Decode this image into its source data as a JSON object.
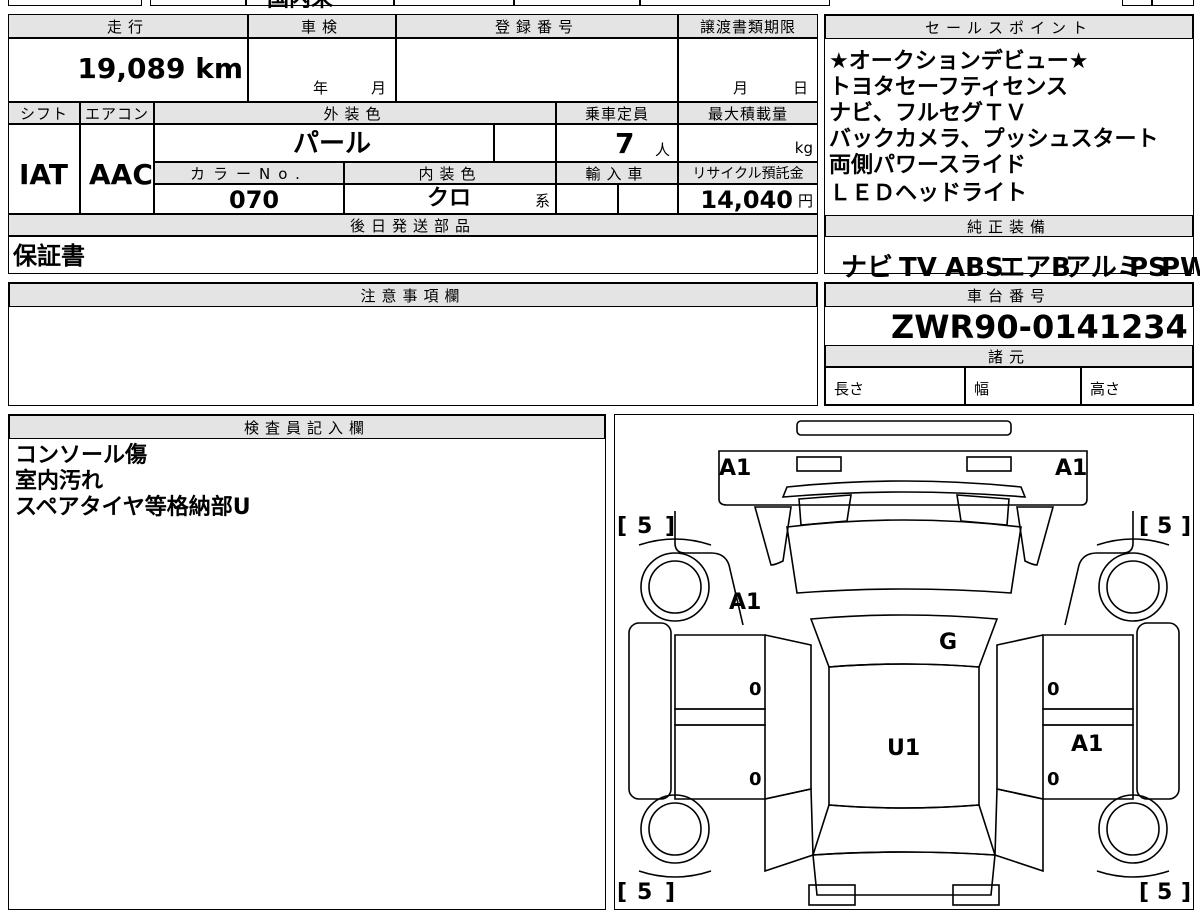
{
  "top_strip": {
    "partial_text": "国内未"
  },
  "vehicle_info": {
    "mileage_label": "走行",
    "mileage_value": "19,089 km",
    "inspection_label": "車検",
    "inspection_year_unit": "年",
    "inspection_month_unit": "月",
    "registration_label": "登録番号",
    "registration_value": "",
    "transfer_doc_label": "譲渡書類期限",
    "transfer_month_unit": "月",
    "transfer_day_unit": "日",
    "shift_label": "シフト",
    "shift_value": "IAT",
    "aircon_label": "エアコン",
    "aircon_value": "AAC",
    "exterior_color_label": "外装色",
    "exterior_color_value": "パール",
    "capacity_label": "乗車定員",
    "capacity_value": "7",
    "capacity_unit": "人",
    "max_load_label": "最大積載量",
    "max_load_unit": "kg",
    "color_no_label": "カラーNo.",
    "color_no_value": "070",
    "interior_color_label": "内装色",
    "interior_color_value": "クロ",
    "interior_color_suffix": "系",
    "import_label": "輸入車",
    "recycle_label": "リサイクル預託金",
    "recycle_value": "14,040",
    "recycle_unit": "円"
  },
  "later_parts": {
    "label": "後日発送部品",
    "value": "保証書"
  },
  "caution": {
    "label": "注意事項欄",
    "value": ""
  },
  "sales_points": {
    "label": "セールスポイント",
    "items": [
      "★オークションデビュー★",
      "トヨタセーフティセンス",
      "ナビ、フルセグＴＶ",
      "バックカメラ、プッシュスタート",
      "両側パワースライド",
      "ＬＥＤヘッドライト"
    ]
  },
  "genuine_equipment": {
    "label": "純正装備",
    "items": [
      "ナビ",
      "TV",
      "ABS",
      "エアB",
      "アルミ",
      "PS",
      "PW"
    ]
  },
  "chassis": {
    "label": "車台番号",
    "value": "ZWR90-0141234"
  },
  "specs": {
    "label": "諸元",
    "length_label": "長さ",
    "width_label": "幅",
    "height_label": "高さ"
  },
  "inspector": {
    "label": "検査員記入欄",
    "notes": [
      "コンソール傷",
      "室内汚れ",
      "スペアタイヤ等格納部U"
    ]
  },
  "diagram": {
    "marks": {
      "front_left_corner": "A1",
      "front_right_corner": "A1",
      "left_front_fender": "A1",
      "windshield": "G",
      "interior": "U1",
      "right_rear_door": "A1",
      "left_front_door_zero": "0",
      "left_rear_door_zero": "0",
      "right_front_door_zero": "0",
      "right_rear_door_zero": "0"
    },
    "tire_left_open": "[",
    "tire_right_close": "]",
    "tire_front_left": "5",
    "tire_front_right": "5",
    "tire_rear_left": "5",
    "tire_rear_right": "5"
  }
}
